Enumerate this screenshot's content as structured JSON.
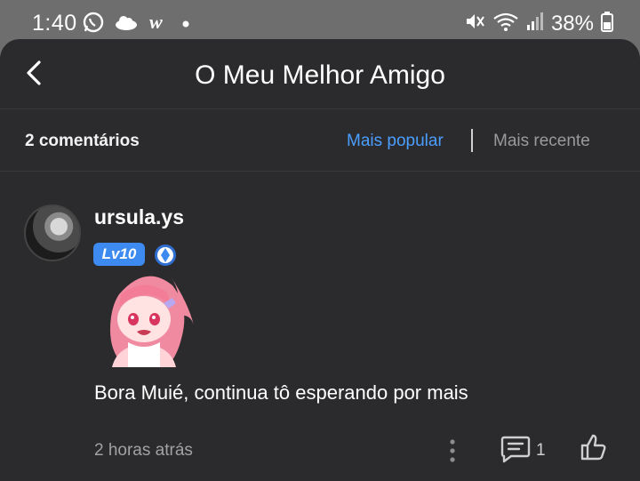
{
  "status_bar": {
    "time": "1:40",
    "battery": "38%",
    "icons_left": [
      "whatsapp-icon",
      "cloud-icon",
      "webnovel-icon",
      "dot-icon"
    ],
    "icons_right": [
      "mute-icon",
      "wifi-icon",
      "signal-icon",
      "battery-icon"
    ]
  },
  "header": {
    "title": "O Meu Melhor Amigo"
  },
  "sort_bar": {
    "count_label": "2 comentários",
    "popular_label": "Mais popular",
    "recent_label": "Mais recente",
    "active_color": "#4a9eff"
  },
  "comment": {
    "username": "ursula.ys",
    "level": "Lv10",
    "text": "Bora Muié, continua tô esperando por mais",
    "timestamp": "2 horas atrás",
    "reply_count": "1"
  }
}
